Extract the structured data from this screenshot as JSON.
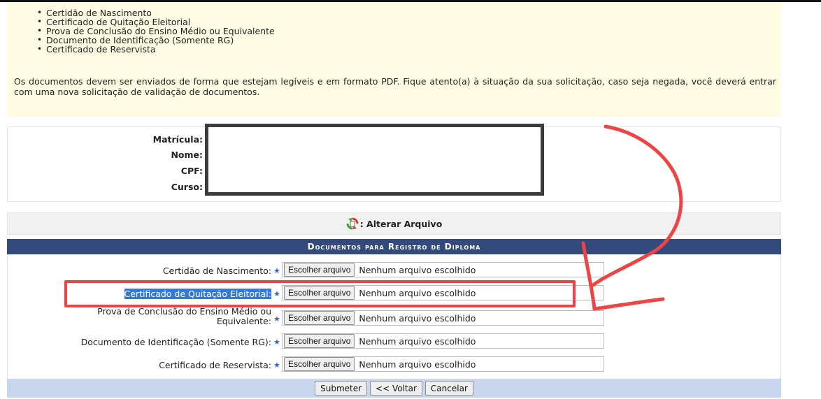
{
  "notice": {
    "items": [
      "Certidão de Nascimento",
      "Certificado de Quitação Eleitorial",
      "Prova de Conclusão do Ensino Médio ou Equivalente",
      "Documento de Identificação (Somente RG)",
      "Certificado de Reservista"
    ],
    "paragraph": "Os documentos devem ser enviados de forma que estejam legíveis e em formato PDF. Fique atento(a) à situação da sua solicitação, caso seja negada, você deverá entrar com uma nova solicitação de validação de documentos."
  },
  "student": {
    "matricula_label": "Matrícula:",
    "nome_label": "Nome:",
    "cpf_label": "CPF:",
    "curso_label": "Curso:"
  },
  "legend": {
    "alterar_label": ": Alterar Arquivo",
    "icon": "refresh-file-icon"
  },
  "documents": {
    "header": "Documentos para Registro de Diploma",
    "rows": [
      {
        "label": "Certidão de Nascimento:",
        "button": "Escolher arquivo",
        "file": "Nenhum arquivo escolhido"
      },
      {
        "label": "Certificado de Quitação Eleitorial:",
        "button": "Escolher arquivo",
        "file": "Nenhum arquivo escolhido"
      },
      {
        "label_line1": "Prova de Conclusão do Ensino Médio ou",
        "label_line2": "Equivalente:",
        "button": "Escolher arquivo",
        "file": "Nenhum arquivo escolhido"
      },
      {
        "label": "Documento de Identificação (Somente RG):",
        "button": "Escolher arquivo",
        "file": "Nenhum arquivo escolhido"
      },
      {
        "label": "Certificado de Reservista:",
        "button": "Escolher arquivo",
        "file": "Nenhum arquivo escolhido"
      }
    ],
    "required_mark": "★"
  },
  "actions": {
    "submit": "Submeter",
    "back": "<< Voltar",
    "cancel": "Cancelar"
  },
  "colors": {
    "header_bg": "#344a7c",
    "notice_bg": "#fefde3",
    "footer_bg": "#c8d5ec",
    "annotation": "#ee4444",
    "selection": "#3578d6"
  }
}
